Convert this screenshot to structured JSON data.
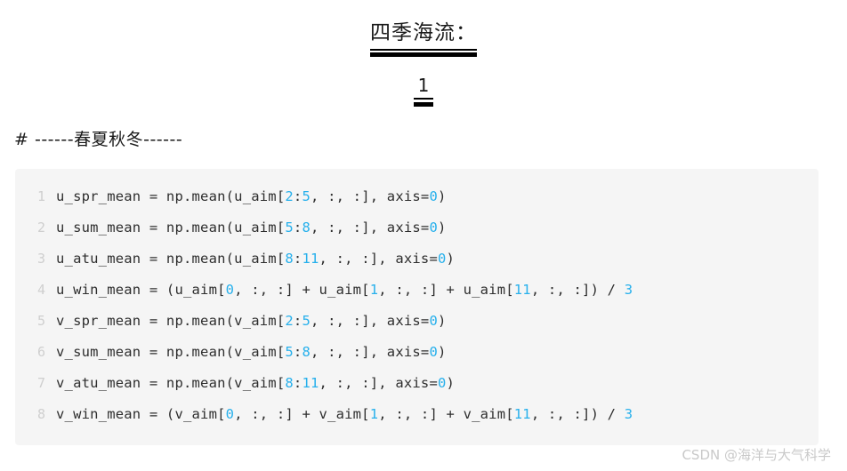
{
  "title": {
    "main": "四季海流：",
    "sub": "1"
  },
  "comment": {
    "text": "# ------春夏秋冬------"
  },
  "code_block": {
    "language": "python",
    "background_color": "#f5f5f5",
    "text_color": "#2e2e2e",
    "number_token_color": "#27b0ec",
    "line_number_color": "#cfcfcf",
    "lines": [
      {
        "number": "1",
        "text": "u_spr_mean = np.mean(u_aim[2:5, :, :], axis=0)",
        "tokens": [
          {
            "t": "u_spr_mean = np.mean(u_aim[",
            "k": "plain"
          },
          {
            "t": "2",
            "k": "num"
          },
          {
            "t": ":",
            "k": "plain"
          },
          {
            "t": "5",
            "k": "num"
          },
          {
            "t": ", :, :], axis=",
            "k": "plain"
          },
          {
            "t": "0",
            "k": "num"
          },
          {
            "t": ")",
            "k": "plain"
          }
        ]
      },
      {
        "number": "2",
        "text": "u_sum_mean = np.mean(u_aim[5:8, :, :], axis=0)",
        "tokens": [
          {
            "t": "u_sum_mean = np.mean(u_aim[",
            "k": "plain"
          },
          {
            "t": "5",
            "k": "num"
          },
          {
            "t": ":",
            "k": "plain"
          },
          {
            "t": "8",
            "k": "num"
          },
          {
            "t": ", :, :], axis=",
            "k": "plain"
          },
          {
            "t": "0",
            "k": "num"
          },
          {
            "t": ")",
            "k": "plain"
          }
        ]
      },
      {
        "number": "3",
        "text": "u_atu_mean = np.mean(u_aim[8:11, :, :], axis=0)",
        "tokens": [
          {
            "t": "u_atu_mean = np.mean(u_aim[",
            "k": "plain"
          },
          {
            "t": "8",
            "k": "num"
          },
          {
            "t": ":",
            "k": "plain"
          },
          {
            "t": "11",
            "k": "num"
          },
          {
            "t": ", :, :], axis=",
            "k": "plain"
          },
          {
            "t": "0",
            "k": "num"
          },
          {
            "t": ")",
            "k": "plain"
          }
        ]
      },
      {
        "number": "4",
        "text": "u_win_mean = (u_aim[0, :, :] + u_aim[1, :, :] + u_aim[11, :, :]) / 3",
        "tokens": [
          {
            "t": "u_win_mean = (u_aim[",
            "k": "plain"
          },
          {
            "t": "0",
            "k": "num"
          },
          {
            "t": ", :, :] + u_aim[",
            "k": "plain"
          },
          {
            "t": "1",
            "k": "num"
          },
          {
            "t": ", :, :] + u_aim[",
            "k": "plain"
          },
          {
            "t": "11",
            "k": "num"
          },
          {
            "t": ", :, :]) / ",
            "k": "plain"
          },
          {
            "t": "3",
            "k": "num"
          }
        ]
      },
      {
        "number": "5",
        "text": "v_spr_mean = np.mean(v_aim[2:5, :, :], axis=0)",
        "tokens": [
          {
            "t": "v_spr_mean = np.mean(v_aim[",
            "k": "plain"
          },
          {
            "t": "2",
            "k": "num"
          },
          {
            "t": ":",
            "k": "plain"
          },
          {
            "t": "5",
            "k": "num"
          },
          {
            "t": ", :, :], axis=",
            "k": "plain"
          },
          {
            "t": "0",
            "k": "num"
          },
          {
            "t": ")",
            "k": "plain"
          }
        ]
      },
      {
        "number": "6",
        "text": "v_sum_mean = np.mean(v_aim[5:8, :, :], axis=0)",
        "tokens": [
          {
            "t": "v_sum_mean = np.mean(v_aim[",
            "k": "plain"
          },
          {
            "t": "5",
            "k": "num"
          },
          {
            "t": ":",
            "k": "plain"
          },
          {
            "t": "8",
            "k": "num"
          },
          {
            "t": ", :, :], axis=",
            "k": "plain"
          },
          {
            "t": "0",
            "k": "num"
          },
          {
            "t": ")",
            "k": "plain"
          }
        ]
      },
      {
        "number": "7",
        "text": "v_atu_mean = np.mean(v_aim[8:11, :, :], axis=0)",
        "tokens": [
          {
            "t": "v_atu_mean = np.mean(v_aim[",
            "k": "plain"
          },
          {
            "t": "8",
            "k": "num"
          },
          {
            "t": ":",
            "k": "plain"
          },
          {
            "t": "11",
            "k": "num"
          },
          {
            "t": ", :, :], axis=",
            "k": "plain"
          },
          {
            "t": "0",
            "k": "num"
          },
          {
            "t": ")",
            "k": "plain"
          }
        ]
      },
      {
        "number": "8",
        "text": "v_win_mean = (v_aim[0, :, :] + v_aim[1, :, :] + v_aim[11, :, :]) / 3",
        "tokens": [
          {
            "t": "v_win_mean = (v_aim[",
            "k": "plain"
          },
          {
            "t": "0",
            "k": "num"
          },
          {
            "t": ", :, :] + v_aim[",
            "k": "plain"
          },
          {
            "t": "1",
            "k": "num"
          },
          {
            "t": ", :, :] + v_aim[",
            "k": "plain"
          },
          {
            "t": "11",
            "k": "num"
          },
          {
            "t": ", :, :]) / ",
            "k": "plain"
          },
          {
            "t": "3",
            "k": "num"
          }
        ]
      }
    ]
  },
  "watermark": {
    "text": "CSDN @海洋与大气科学"
  }
}
